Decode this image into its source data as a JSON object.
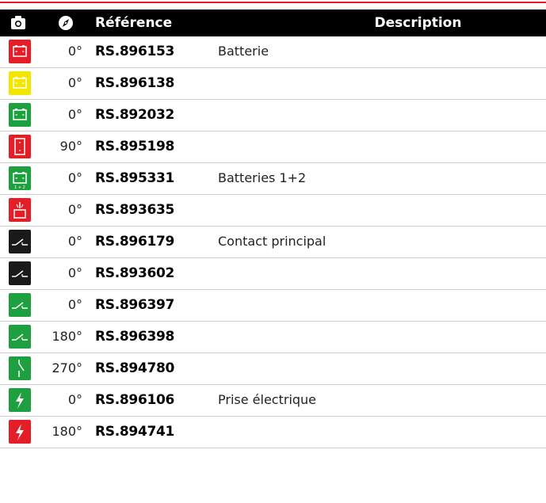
{
  "header": {
    "camera_icon": "camera-icon",
    "compass_icon": "compass-icon",
    "reference_label": "Référence",
    "description_label": "Description"
  },
  "colors": {
    "accent_red": "#e41e26",
    "header_bg": "#000000"
  },
  "rows": [
    {
      "icon": "battery-icon",
      "icon_color": "#e41e26",
      "angle": "0°",
      "ref": "RS.896153",
      "desc": "Batterie"
    },
    {
      "icon": "battery-icon",
      "icon_color": "#f2e600",
      "angle": "0°",
      "ref": "RS.896138",
      "desc": ""
    },
    {
      "icon": "battery-icon",
      "icon_color": "#1ea040",
      "angle": "0°",
      "ref": "RS.892032",
      "desc": ""
    },
    {
      "icon": "battery-vertical-icon",
      "icon_color": "#e41e26",
      "angle": "90°",
      "ref": "RS.895198",
      "desc": ""
    },
    {
      "icon": "batteries-icon",
      "icon_color": "#1ea040",
      "angle": "0°",
      "ref": "RS.895331",
      "desc": "Batteries 1+2"
    },
    {
      "icon": "batteries-switch-icon",
      "icon_color": "#e41e26",
      "angle": "0°",
      "ref": "RS.893635",
      "desc": ""
    },
    {
      "icon": "main-switch-icon",
      "icon_color": "#1a1a1a",
      "angle": "0°",
      "ref": "RS.896179",
      "desc": "Contact principal"
    },
    {
      "icon": "main-switch-icon",
      "icon_color": "#1a1a1a",
      "angle": "0°",
      "ref": "RS.893602",
      "desc": ""
    },
    {
      "icon": "main-switch-icon",
      "icon_color": "#1ea040",
      "angle": "0°",
      "ref": "RS.896397",
      "desc": ""
    },
    {
      "icon": "main-switch-icon",
      "icon_color": "#1ea040",
      "angle": "180°",
      "ref": "RS.896398",
      "desc": ""
    },
    {
      "icon": "main-switch-vertical-icon",
      "icon_color": "#1ea040",
      "angle": "270°",
      "ref": "RS.894780",
      "desc": ""
    },
    {
      "icon": "power-plug-icon",
      "icon_color": "#1ea040",
      "angle": "0°",
      "ref": "RS.896106",
      "desc": "Prise électrique"
    },
    {
      "icon": "power-plug-icon",
      "icon_color": "#e41e26",
      "angle": "180°",
      "ref": "RS.894741",
      "desc": ""
    }
  ]
}
